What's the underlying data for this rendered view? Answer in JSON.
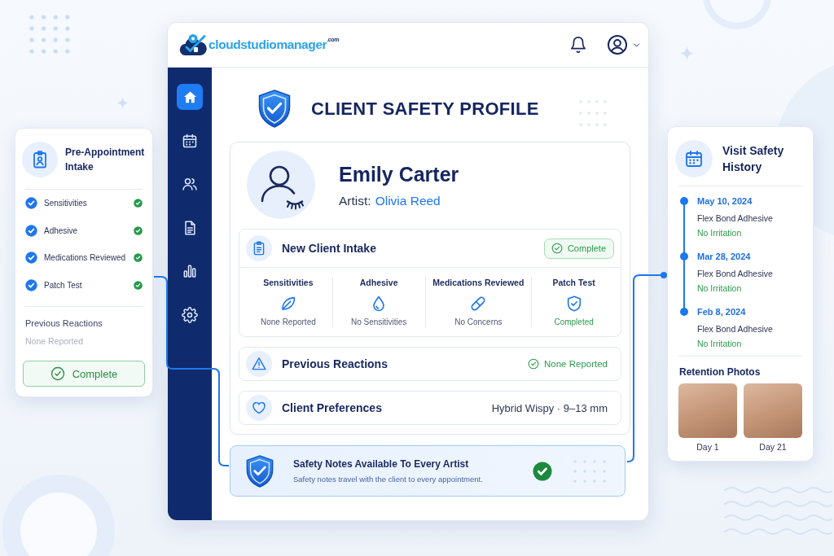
{
  "logo": {
    "text": "cloud**studio**manager$^{.com}$"
  },
  "sidebar": {
    "items": [
      {
        "kind": "home",
        "selected": true
      },
      {
        "kind": "calendar",
        "selected": false
      },
      {
        "kind": "clients",
        "selected": false
      },
      {
        "kind": "documents",
        "selected": false
      },
      {
        "kind": "reports",
        "selected": false
      },
      {
        "kind": "settings",
        "selected": false
      }
    ]
  },
  "page_title": "CLIENT SAFETY PROFILE",
  "client": {
    "name": "Emily Carter",
    "artist_label": "Artist:",
    "artist_name": "Olivia Reed"
  },
  "intake": {
    "title": "New Client Intake",
    "status": "Complete",
    "items": [
      {
        "kind": "leaf",
        "label": "Sensitivities",
        "value": "None Reported",
        "positive": false
      },
      {
        "kind": "drop",
        "label": "Adhesive",
        "value": "No Sensitivities",
        "positive": false
      },
      {
        "kind": "pill",
        "label": "Medications Reviewed",
        "value": "No Concerns",
        "positive": false
      },
      {
        "kind": "shield",
        "label": "Patch Test",
        "value": "Completed",
        "positive": true
      }
    ]
  },
  "sections": [
    {
      "kind": "warning",
      "title": "Previous Reactions",
      "value": "None Reported",
      "ok": true
    },
    {
      "kind": "heart",
      "title": "Client Preferences",
      "value": "Hybrid Wispy · 9–13 mm",
      "ok": false
    }
  ],
  "safety_banner": {
    "title": "Safety Notes Available To Every Artist",
    "text": "Safety notes travel with the client to every appointment.",
    "verified": true
  },
  "intake_card": {
    "title": "Pre-Appointment Intake",
    "items": [
      {
        "label": "Sensitivities",
        "checked": true,
        "verified": true
      },
      {
        "label": "Adhesive",
        "checked": true,
        "verified": true
      },
      {
        "label": "Medications Reviewed",
        "checked": true,
        "verified": true
      },
      {
        "label": "Patch Test",
        "checked": true,
        "verified": true
      }
    ],
    "reactions_label": "Previous Reactions",
    "reactions_value": "None Reported",
    "button": "Complete"
  },
  "history": {
    "title": "Visit Safety History",
    "visits": [
      {
        "date": "May 10, 2024",
        "product": "Flex Bond Adhesive",
        "result": "No Irritation"
      },
      {
        "date": "Mar 28, 2024",
        "product": "Flex Bond Adhesive",
        "result": "No Irritation"
      },
      {
        "date": "Feb 8, 2024",
        "product": "Flex Bond Adhesive",
        "result": "No Irritation"
      }
    ],
    "photos_title": "Retention Photos",
    "photos": [
      {
        "caption": "Day 1"
      },
      {
        "caption": "Day 21"
      }
    ]
  }
}
